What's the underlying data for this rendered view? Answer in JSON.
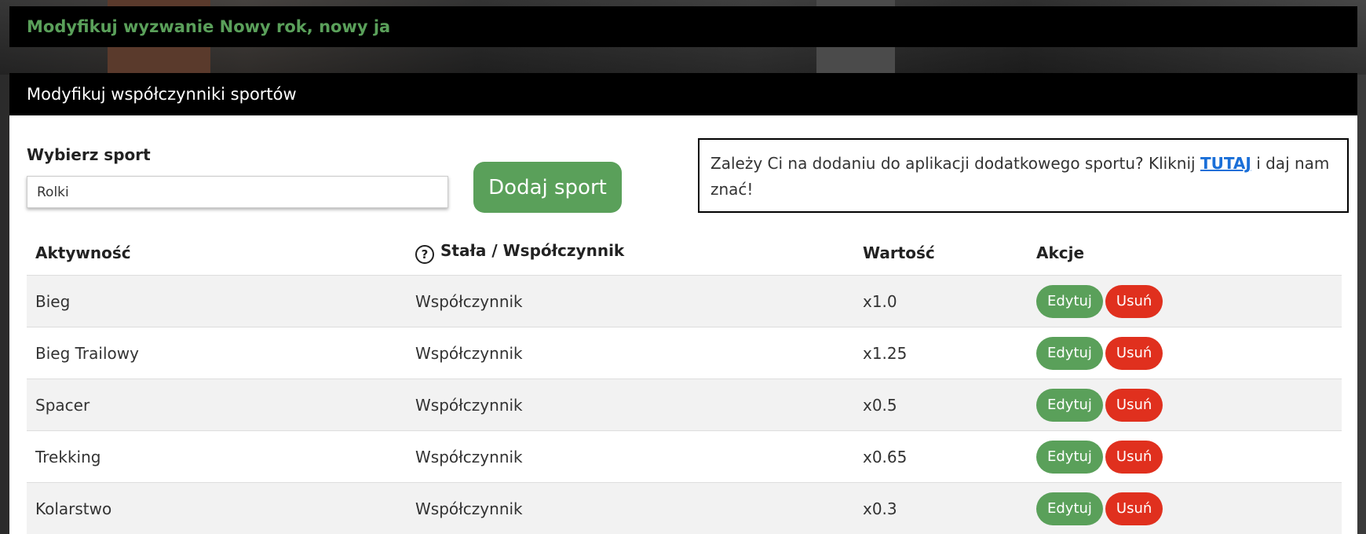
{
  "header": {
    "title": "Modyfikuj wyzwanie Nowy rok, nowy ja"
  },
  "card": {
    "title": "Modyfikuj współczynniki sportów",
    "select_label": "Wybierz sport",
    "select_value": "Rolki",
    "add_button": "Dodaj sport",
    "info": {
      "text_before": "Zależy Ci na dodaniu do aplikacji dodatkowego sportu? Kliknij ",
      "link": "TUTAJ",
      "text_after": " i daj nam znać!"
    }
  },
  "table": {
    "headers": {
      "activity": "Aktywność",
      "type": "Stała / Współczynnik",
      "value": "Wartość",
      "actions": "Akcje"
    },
    "rows": [
      {
        "activity": "Bieg",
        "type": "Współczynnik",
        "value": "x1.0"
      },
      {
        "activity": "Bieg Trailowy",
        "type": "Współczynnik",
        "value": "x1.25"
      },
      {
        "activity": "Spacer",
        "type": "Współczynnik",
        "value": "x0.5"
      },
      {
        "activity": "Trekking",
        "type": "Współczynnik",
        "value": "x0.65"
      },
      {
        "activity": "Kolarstwo",
        "type": "Współczynnik",
        "value": "x0.3"
      }
    ],
    "edit_label": "Edytuj",
    "delete_label": "Usuń"
  },
  "colors": {
    "accent_green": "#5aa05a",
    "danger_red": "#e0301e",
    "link_blue": "#1a6fd8"
  }
}
